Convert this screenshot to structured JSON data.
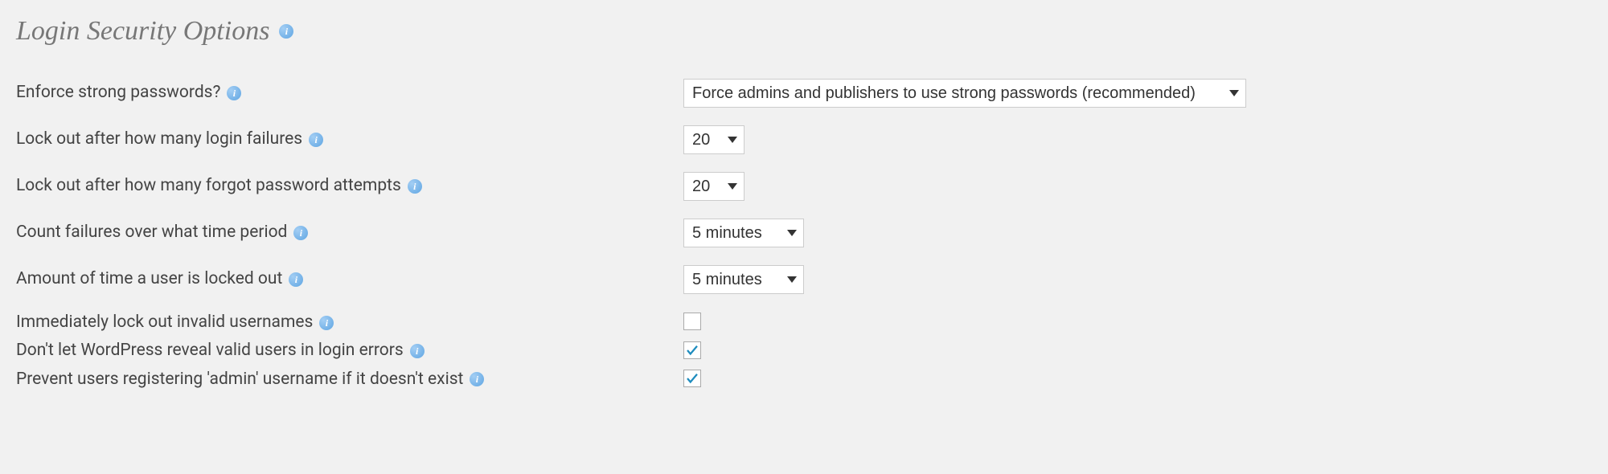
{
  "section_title": "Login Security Options",
  "fields": {
    "enforce_strong": {
      "label": "Enforce strong passwords?",
      "value": "Force admins and publishers to use strong passwords (recommended)"
    },
    "lockout_failures": {
      "label": "Lock out after how many login failures",
      "value": "20"
    },
    "lockout_forgot": {
      "label": "Lock out after how many forgot password attempts",
      "value": "20"
    },
    "count_period": {
      "label": "Count failures over what time period",
      "value": "5 minutes"
    },
    "lockout_time": {
      "label": "Amount of time a user is locked out",
      "value": "5 minutes"
    },
    "lock_invalid": {
      "label": "Immediately lock out invalid usernames",
      "checked": false
    },
    "hide_valid_users": {
      "label": "Don't let WordPress reveal valid users in login errors",
      "checked": true
    },
    "prevent_admin_username": {
      "label": "Prevent users registering 'admin' username if it doesn't exist",
      "checked": true
    }
  }
}
